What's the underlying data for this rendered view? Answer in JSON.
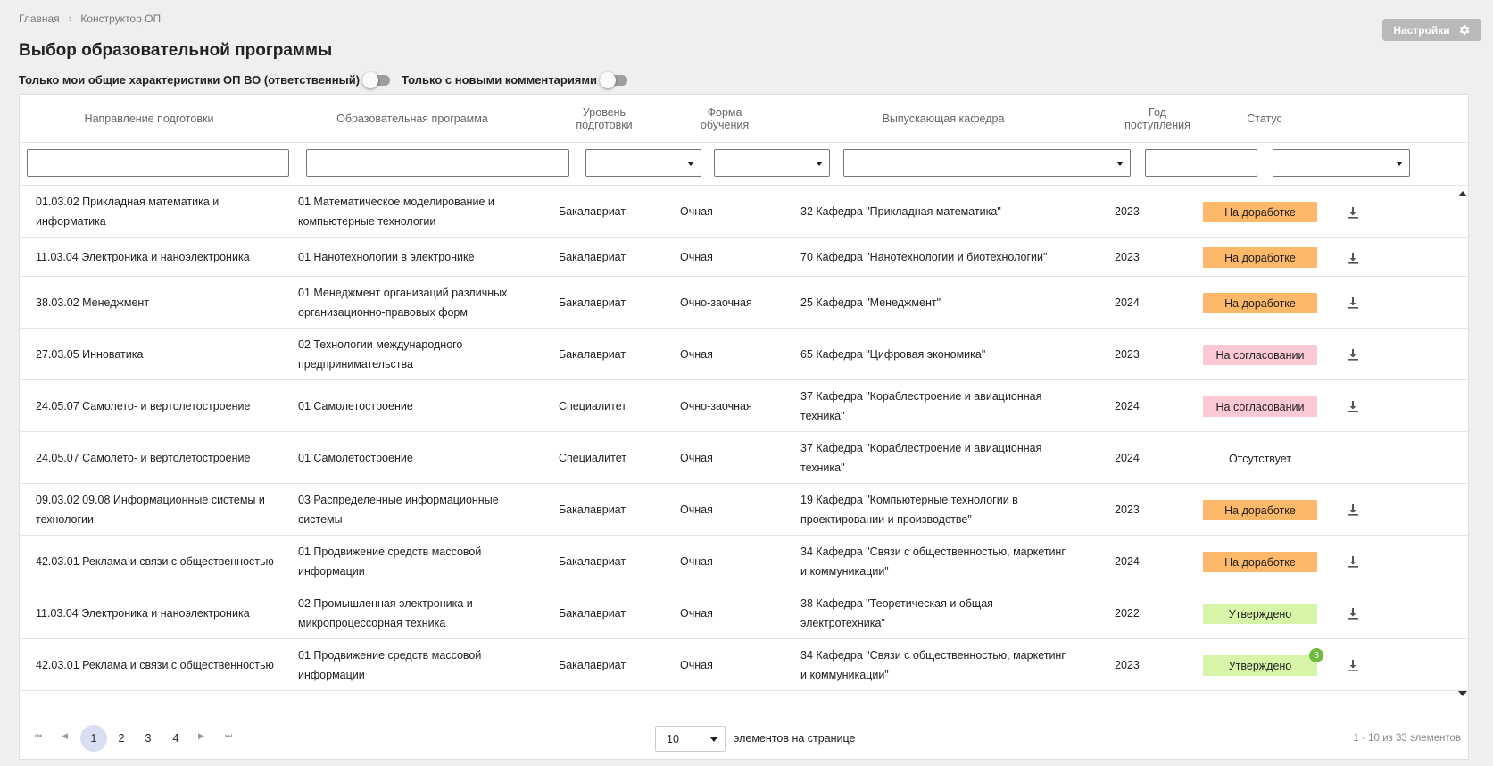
{
  "breadcrumb": {
    "home": "Главная",
    "separator": "›",
    "current": "Конструктор ОП"
  },
  "settings": {
    "label": "Настройки",
    "icon": "gear-icon"
  },
  "title": "Выбор образовательной программы",
  "toggles": [
    {
      "label": "Только мои общие характеристики ОП ВО (ответственный)",
      "on": false
    },
    {
      "label": "Только с новыми комментариями",
      "on": false
    }
  ],
  "columns": {
    "direction": "Направление подготовки",
    "program": "Образовательная программа",
    "level": "Уровень подготовки",
    "form": "Форма обучения",
    "department": "Выпускающая кафедра",
    "year": "Год поступления",
    "status": "Статус"
  },
  "rows": [
    {
      "direction": "01.03.02 Прикладная математика и информатика",
      "program": "01 Математическое моделирование и компьютерные технологии",
      "level": "Бакалавриат",
      "form": "Очная",
      "department": "32 Кафедра \"Прикладная математика\"",
      "year": "2023",
      "status": "На доработке",
      "status_color": "#fdb869",
      "download": true
    },
    {
      "direction": "11.03.04 Электроника и наноэлектроника",
      "program": "01 Нанотехнологии в электронике",
      "level": "Бакалавриат",
      "form": "Очная",
      "department": "70 Кафедра \"Нанотехнологии и биотехнологии\"",
      "year": "2023",
      "status": "На доработке",
      "status_color": "#fdb869",
      "download": true
    },
    {
      "direction": "38.03.02 Менеджмент",
      "program": "01 Менеджмент организаций различных организационно-правовых форм",
      "level": "Бакалавриат",
      "form": "Очно-заочная",
      "department": "25 Кафедра \"Менеджмент\"",
      "year": "2024",
      "status": "На доработке",
      "status_color": "#fdb869",
      "download": true
    },
    {
      "direction": "27.03.05 Инноватика",
      "program": "02 Технологии международного предпринимательства",
      "level": "Бакалавриат",
      "form": "Очная",
      "department": "65 Кафедра \"Цифровая экономика\"",
      "year": "2023",
      "status": "На согласовании",
      "status_color": "#fbc9d3",
      "download": true
    },
    {
      "direction": "24.05.07 Самолето- и вертолетостроение",
      "program": "01 Самолетостроение",
      "level": "Специалитет",
      "form": "Очно-заочная",
      "department": "37 Кафедра \"Кораблестроение и авиационная техника\"",
      "year": "2024",
      "status": "На согласовании",
      "status_color": "#fbc9d3",
      "download": true
    },
    {
      "direction": "24.05.07 Самолето- и вертолетостроение",
      "program": "01 Самолетостроение",
      "level": "Специалитет",
      "form": "Очная",
      "department": "37 Кафедра \"Кораблестроение и авиационная техника\"",
      "year": "2024",
      "status": "Отсутствует",
      "status_color": "transparent",
      "download": false
    },
    {
      "direction": "09.03.02 09.08 Информационные системы и технологии",
      "program": "03 Распределенные информационные системы",
      "level": "Бакалавриат",
      "form": "Очная",
      "department": "19 Кафедра \"Компьютерные технологии в проектировании и производстве\"",
      "year": "2023",
      "status": "На доработке",
      "status_color": "#fdb869",
      "download": true
    },
    {
      "direction": "42.03.01 Реклама и связи с общественностью",
      "program": "01 Продвижение средств массовой информации",
      "level": "Бакалавриат",
      "form": "Очная",
      "department": "34 Кафедра \"Связи с общественностью, маркетинг и коммуникации\"",
      "year": "2024",
      "status": "На доработке",
      "status_color": "#fdb869",
      "download": true
    },
    {
      "direction": "11.03.04 Электроника и наноэлектроника",
      "program": "02 Промышленная электроника и микропроцессорная техника",
      "level": "Бакалавриат",
      "form": "Очная",
      "department": "38 Кафедра \"Теоретическая и общая электротехника\"",
      "year": "2022",
      "status": "Утверждено",
      "status_color": "#d6f5a8",
      "download": true
    },
    {
      "direction": "42.03.01 Реклама и связи с общественностью",
      "program": "01 Продвижение средств массовой информации",
      "level": "Бакалавриат",
      "form": "Очная",
      "department": "34 Кафедра \"Связи с общественностью, маркетинг и коммуникации\"",
      "year": "2023",
      "status": "Утверждено",
      "status_color": "#d6f5a8",
      "download": true,
      "notification": "3"
    }
  ],
  "pagination": {
    "pages": [
      "1",
      "2",
      "3",
      "4"
    ],
    "active_page": "1",
    "page_size": "10",
    "page_size_label": "элементов на странице",
    "total": "1 - 10 из 33 элементов"
  }
}
